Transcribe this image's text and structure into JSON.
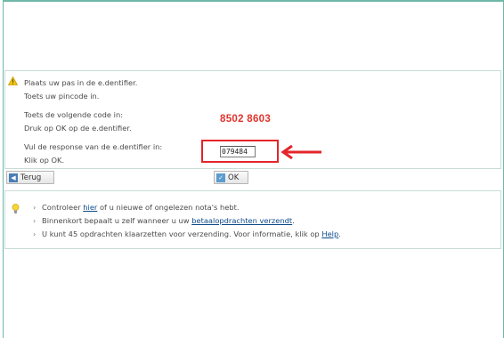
{
  "instructions": {
    "line1": "Plaats uw pas in de e.dentifier.",
    "line2": "Toets uw pincode in.",
    "line3": "Toets de volgende code in:",
    "line4": "Druk op OK op de e.dentifier.",
    "line5": "Vul de response van de e.dentifier in:",
    "line6": "Klik op OK.",
    "challenge_code": "8502 8603",
    "response_value": "079484"
  },
  "buttons": {
    "back_label": "Terug",
    "ok_label": "OK"
  },
  "info": {
    "b1_pre": "Controleer ",
    "b1_link": "hier",
    "b1_post": " of u nieuwe of ongelezen nota's hebt.",
    "b2_pre": "Binnenkort bepaalt u zelf wanneer u uw ",
    "b2_link": "betaalopdrachten verzendt",
    "b2_post": ".",
    "b3_pre": "U kunt 45 opdrachten klaarzetten voor verzending. Voor informatie, klik op ",
    "b3_link": "Help",
    "b3_post": "."
  },
  "colors": {
    "frame": "#6fb7a8",
    "code": "#e0342c",
    "highlight": "#e5242a",
    "link": "#0b4a8a"
  },
  "icons": {
    "warning": "warning-icon",
    "back": "back-arrow-icon",
    "ok": "check-icon",
    "hint": "lightbulb-icon"
  }
}
